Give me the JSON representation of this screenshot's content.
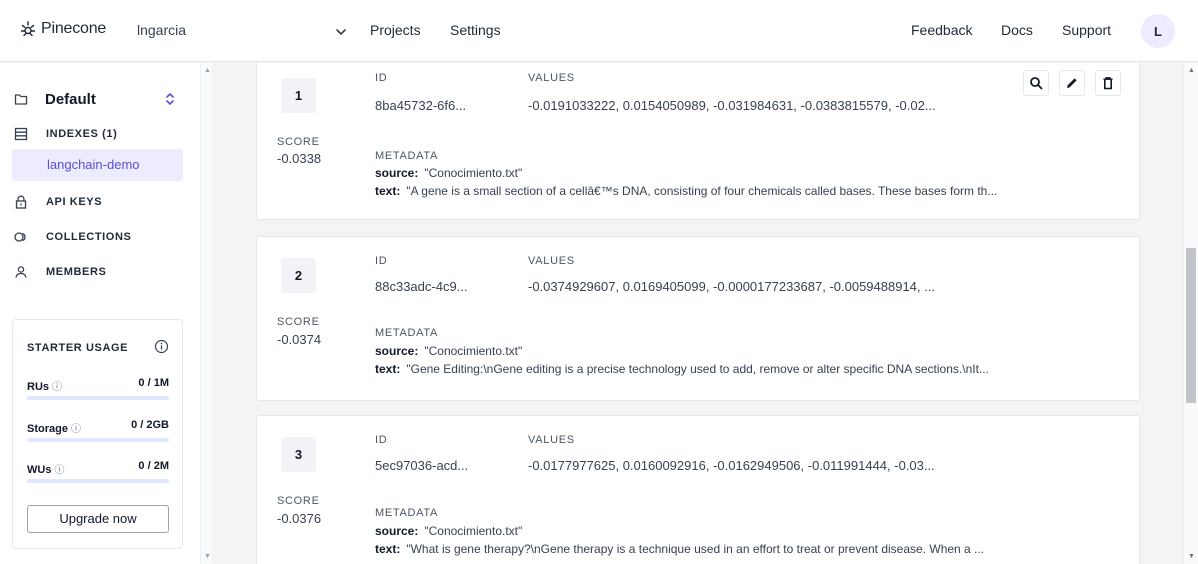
{
  "header": {
    "logo": "Pinecone",
    "org": "lngarcia",
    "nav": [
      "Projects",
      "Settings"
    ],
    "right_links": [
      "Feedback",
      "Docs",
      "Support"
    ],
    "avatar": "L"
  },
  "sidebar": {
    "project": "Default",
    "items": [
      {
        "label": "INDEXES (1)",
        "icon": "database-icon"
      },
      {
        "label": "API KEYS",
        "icon": "lock-icon"
      },
      {
        "label": "COLLECTIONS",
        "icon": "collections-icon"
      },
      {
        "label": "MEMBERS",
        "icon": "user-icon"
      }
    ],
    "sub_item": "langchain-demo",
    "usage": {
      "title": "STARTER USAGE",
      "rows": [
        {
          "label": "RUs",
          "value": "0 / 1M"
        },
        {
          "label": "Storage",
          "value": "0 / 2GB"
        },
        {
          "label": "WUs",
          "value": "0 / 2M"
        }
      ],
      "info_glyph": "ⓘ",
      "upgrade": "Upgrade now"
    }
  },
  "labels": {
    "id": "ID",
    "values": "VALUES",
    "score": "SCORE",
    "metadata": "METADATA",
    "source_key": "source:",
    "text_key": "text:"
  },
  "results": [
    {
      "rank": "1",
      "id": "8ba45732-6f6...",
      "values": "-0.0191033222, 0.0154050989, -0.031984631, -0.0383815579, -0.02...",
      "score": "-0.0338",
      "source": "\"Conocimiento.txt\"",
      "text": "\"A gene is a small section of a cellâ€™s DNA, consisting of four chemicals called bases. These bases form th..."
    },
    {
      "rank": "2",
      "id": "88c33adc-4c9...",
      "values": "-0.0374929607, 0.0169405099, -0.0000177233687, -0.0059488914, ...",
      "score": "-0.0374",
      "source": "\"Conocimiento.txt\"",
      "text": "\"Gene Editing:\\nGene editing is a precise technology used to add, remove or alter specific DNA sections.\\nIt..."
    },
    {
      "rank": "3",
      "id": "5ec97036-acd...",
      "values": "-0.0177977625, 0.0160092916, -0.0162949506, -0.011991444, -0.03...",
      "score": "-0.0376",
      "source": "\"Conocimiento.txt\"",
      "text": "\"What is gene therapy?\\nGene therapy is a technique used in an effort to treat or prevent disease. When a ..."
    }
  ],
  "colors": {
    "accent": "#5b4fd6",
    "accent_bg": "#ecebff",
    "page_bg": "#f3f4f6"
  }
}
